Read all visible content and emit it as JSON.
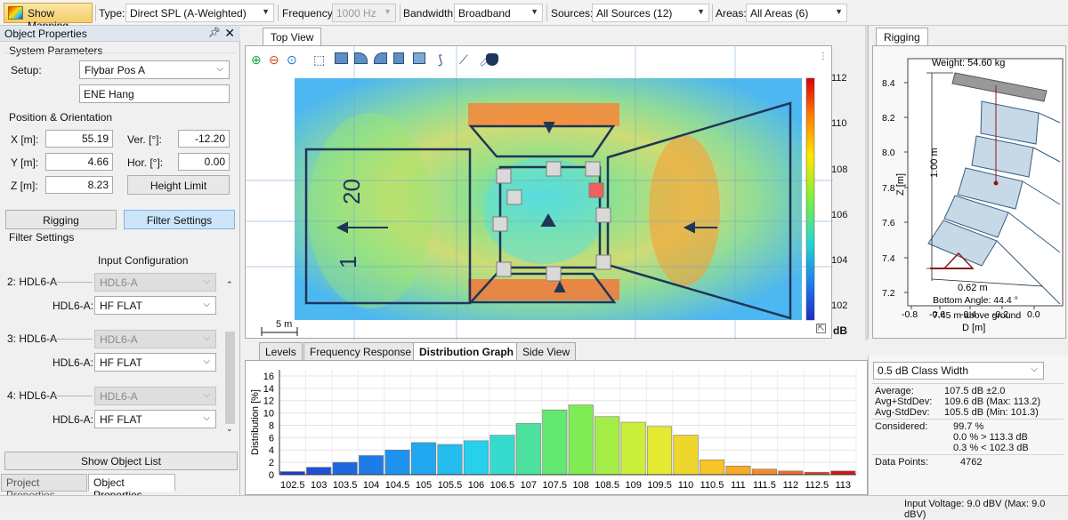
{
  "toolbar": {
    "show_mapping": "Show Mapping",
    "type_label": "Type:",
    "type_value": "Direct SPL (A-Weighted)",
    "frequency_label": "Frequency:",
    "frequency_value": "1000 Hz",
    "bandwidth_label": "Bandwidth:",
    "bandwidth_value": "Broadband",
    "sources_label": "Sources:",
    "sources_value": "All Sources (12)",
    "areas_label": "Areas:",
    "areas_value": "All Areas (6)"
  },
  "left_panel": {
    "title": "Object Properties",
    "pin_icon": "pin-icon",
    "system_parameters": "System Parameters",
    "setup_label": "Setup:",
    "setup_value": "Flybar Pos A",
    "name_value": "ENE Hang",
    "position_orientation": "Position & Orientation",
    "x_label": "X [m]:",
    "x_value": "55.19",
    "y_label": "Y [m]:",
    "y_value": "4.66",
    "z_label": "Z [m]:",
    "z_value": "8.23",
    "ver_label": "Ver. [°]:",
    "ver_value": "-12.20",
    "hor_label": "Hor. [°]:",
    "hor_value": "0.00",
    "height_limit": "Height Limit",
    "rigging_button": "Rigging",
    "filter_settings_button": "Filter Settings",
    "filter_settings_group": "Filter Settings",
    "input_configuration": "Input Configuration",
    "filters": [
      {
        "header": "2: HDL6-A",
        "header_value": "HDL6-A",
        "sub_label": "HDL6-A:",
        "sub_value": "HF FLAT"
      },
      {
        "header": "3: HDL6-A",
        "header_value": "HDL6-A",
        "sub_label": "HDL6-A:",
        "sub_value": "HF FLAT"
      },
      {
        "header": "4: HDL6-A",
        "header_value": "HDL6-A",
        "sub_label": "HDL6-A:",
        "sub_value": "HF FLAT"
      }
    ],
    "show_object_list": "Show Object List",
    "tab_project": "Project Properties",
    "tab_object": "Object Properties"
  },
  "top_view": {
    "tab": "Top View",
    "scale_label": "5 m",
    "colorbar_ticks": [
      "112",
      "110",
      "108",
      "106",
      "104",
      "102"
    ],
    "colorbar_unit": "dB",
    "map_labels": [
      "20",
      "1"
    ]
  },
  "rigging_view": {
    "tab": "Rigging",
    "weight": "Weight: 54.60 kg",
    "height_dim": "1.00 m",
    "width_dim": "0.62 m",
    "bottom_angle": "Bottom Angle: 44.4 °",
    "above_ground": "7.45 m above ground",
    "ylabel": "Z [m]",
    "xlabel": "D [m]",
    "y_ticks": [
      "8.4",
      "8.2",
      "8.0",
      "7.8",
      "7.6",
      "7.4",
      "7.2"
    ],
    "x_ticks": [
      "-0.8",
      "-0.6",
      "-0.4",
      "-0.2",
      "0.0"
    ]
  },
  "bottom_tabs": [
    "Levels",
    "Frequency Response",
    "Distribution Graph",
    "Side View"
  ],
  "stats": {
    "class_width": "0.5 dB Class Width",
    "average_label": "Average:",
    "average_value": "107.5 dB ±2.0",
    "avgp_label": "Avg+StdDev:",
    "avgp_value": "109.6 dB (Max: 113.2)",
    "avgm_label": "Avg-StdDev:",
    "avgm_value": "105.5 dB (Min: 101.3)",
    "considered_label": "Considered:",
    "considered_value": "99.7 %",
    "above_value": "0.0 % > 113.3 dB",
    "below_value": "0.3 % < 102.3 dB",
    "points_label": "Data Points:",
    "points_value": "4762"
  },
  "status": {
    "input_voltage": "Input Voltage: 9.0 dBV (Max: 9.0 dBV)"
  },
  "chart_data": {
    "type": "bar",
    "title": "",
    "ylabel": "Distribution [%]",
    "xlabel": "",
    "ylim": [
      0,
      17
    ],
    "y_ticks": [
      0,
      2,
      4,
      6,
      8,
      10,
      12,
      14,
      16
    ],
    "categories": [
      "102.5",
      "103",
      "103.5",
      "104",
      "104.5",
      "105",
      "105.5",
      "106",
      "106.5",
      "107",
      "107.5",
      "108",
      "108.5",
      "109",
      "109.5",
      "110",
      "110.5",
      "111",
      "111.5",
      "112",
      "112.5",
      "113"
    ],
    "values": [
      0.5,
      1.2,
      2.0,
      3.1,
      4.0,
      5.2,
      4.9,
      5.5,
      6.4,
      8.3,
      10.5,
      11.3,
      9.4,
      8.5,
      7.8,
      6.4,
      2.4,
      1.4,
      0.9,
      0.6,
      0.4,
      0.6
    ],
    "grid": true
  }
}
